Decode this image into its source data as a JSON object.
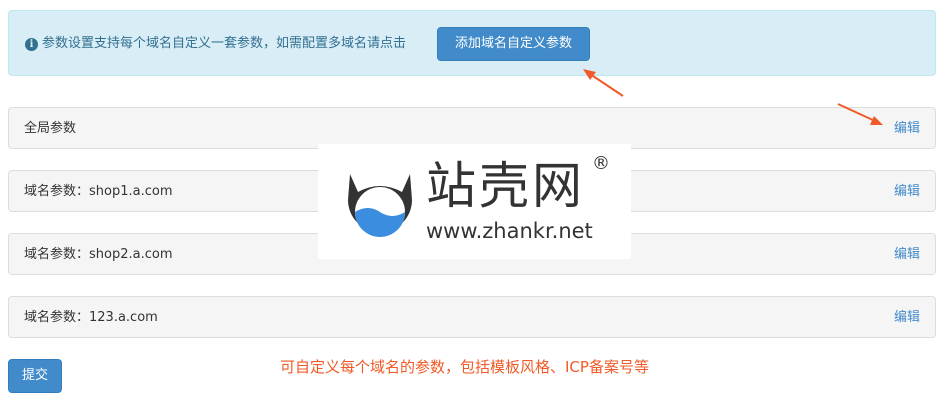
{
  "info": {
    "icon": "info-circle-icon",
    "icon_glyph": "i",
    "text": "参数设置支持每个域名自定义一套参数，如需配置多域名请点击",
    "add_button_label": "添加域名自定义参数"
  },
  "panels": [
    {
      "title": "全局参数",
      "edit_label": "编辑"
    },
    {
      "title": "域名参数：shop1.a.com",
      "edit_label": "编辑"
    },
    {
      "title": "域名参数：shop2.a.com",
      "edit_label": "编辑"
    },
    {
      "title": "域名参数：123.a.com",
      "edit_label": "编辑"
    }
  ],
  "submit_label": "提交",
  "annotation": "可自定义每个域名的参数，包括模板风格、ICP备案号等",
  "watermark": {
    "title": "站壳网",
    "registered_mark": "®",
    "url": "www.zhankr.net"
  },
  "colors": {
    "info_bg": "#d9edf7",
    "info_text": "#31708f",
    "primary": "#428bca",
    "panel_bg": "#f5f5f5",
    "annotation": "#f05a28"
  }
}
